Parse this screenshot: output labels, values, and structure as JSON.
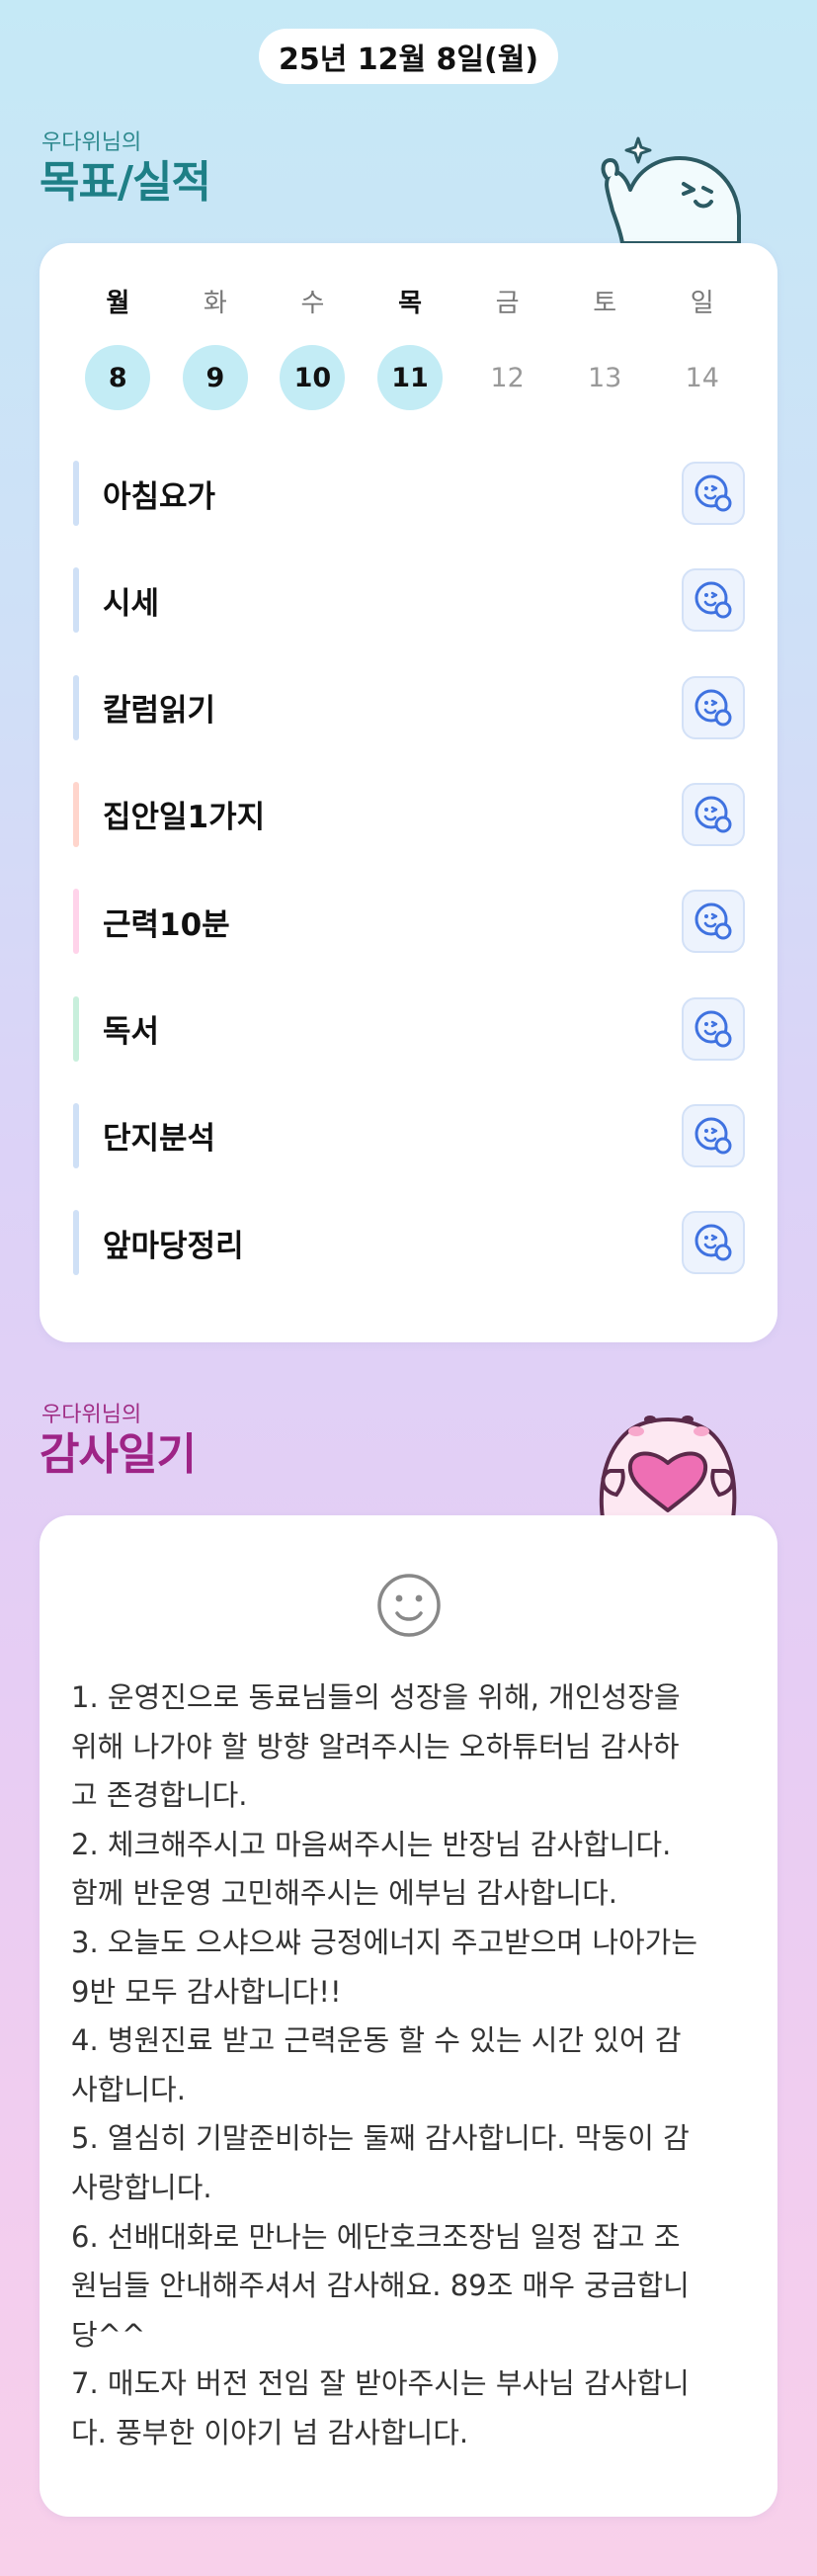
{
  "header": {
    "date": "25년 12월 8일(월)"
  },
  "goals_section": {
    "subtitle": "우다위님의",
    "title": "목표/실적"
  },
  "week": {
    "days": [
      {
        "weekday": "월",
        "date": "8",
        "active": true
      },
      {
        "weekday": "화",
        "date": "9",
        "active": true
      },
      {
        "weekday": "수",
        "date": "10",
        "active": true
      },
      {
        "weekday": "목",
        "date": "11",
        "active": true
      },
      {
        "weekday": "금",
        "date": "12",
        "active": false
      },
      {
        "weekday": "토",
        "date": "13",
        "active": false
      },
      {
        "weekday": "일",
        "date": "14",
        "active": false
      }
    ]
  },
  "goals": [
    {
      "label": "아침요가",
      "color": "#cfe0f6"
    },
    {
      "label": "시세",
      "color": "#cfe0f6"
    },
    {
      "label": "칼럼읽기",
      "color": "#cfe0f6"
    },
    {
      "label": "집안일1가지",
      "color": "#ffd5cc"
    },
    {
      "label": "근력10분",
      "color": "#ffd3ea"
    },
    {
      "label": "독서",
      "color": "#c8efdc"
    },
    {
      "label": "단지분석",
      "color": "#cfe0f6"
    },
    {
      "label": "앞마당정리",
      "color": "#cfe0f6"
    }
  ],
  "gratitude_section": {
    "subtitle": "우다위님의",
    "title": "감사일기"
  },
  "journal": {
    "lines": [
      "1. 운영진으로 동료님들의 성장을 위해, 개인성장을",
      "위해  나가야 할 방향 알려주시는 오하튜터님 감사하",
      "고 존경합니다.",
      "2. 체크해주시고 마음써주시는 반장님 감사합니다.",
      "함께 반운영 고민해주시는 에부님 감사합니다.",
      "3. 오늘도 으샤으쌰 긍정에너지 주고받으며 나아가는",
      "9반 모두 감사합니다!!",
      "4. 병원진료 받고 근력운동 할 수 있는 시간 있어 감",
      "사합니다.",
      "5. 열심히 기말준비하는 둘째 감사합니다. 막둥이 감",
      "사랑합니다.",
      "6. 선배대화로 만나는 에단호크조장님 일정 잡고 조",
      "원님들 안내해주셔서 감사해요. 89조 매우 궁금합니",
      "당^^",
      "7. 매도자 버전 전임 잘 받아주시는 부사님 감사합니",
      "다. 풍부한 이야기 넘 감사합니다."
    ]
  },
  "colors": {
    "accent_teal": "#1e7f86",
    "accent_magenta": "#9e2486",
    "active_day_bg": "#c3ecf5"
  },
  "icons": {
    "goal_button": "smiley-check-icon",
    "journal": "smiley-face-icon"
  }
}
